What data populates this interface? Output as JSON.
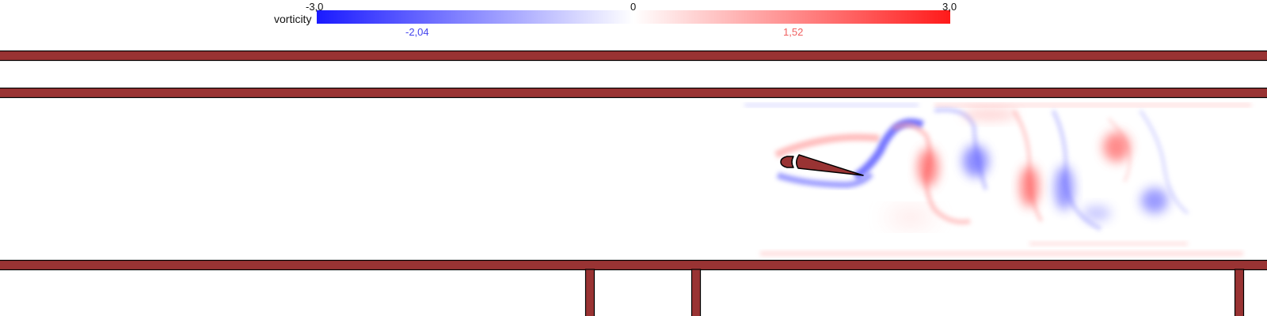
{
  "colorbar": {
    "title": "vorticity",
    "min_label": "-3,0",
    "mid_label": "0",
    "max_label": "3,0",
    "neg_marker_label": "-2,04",
    "pos_marker_label": "1,52",
    "colors": {
      "negative": "#1a1aff",
      "zero": "#ffffff",
      "positive": "#ff1a1a"
    }
  },
  "scene": {
    "wall_color": "#993333",
    "outline_color": "#000000"
  }
}
